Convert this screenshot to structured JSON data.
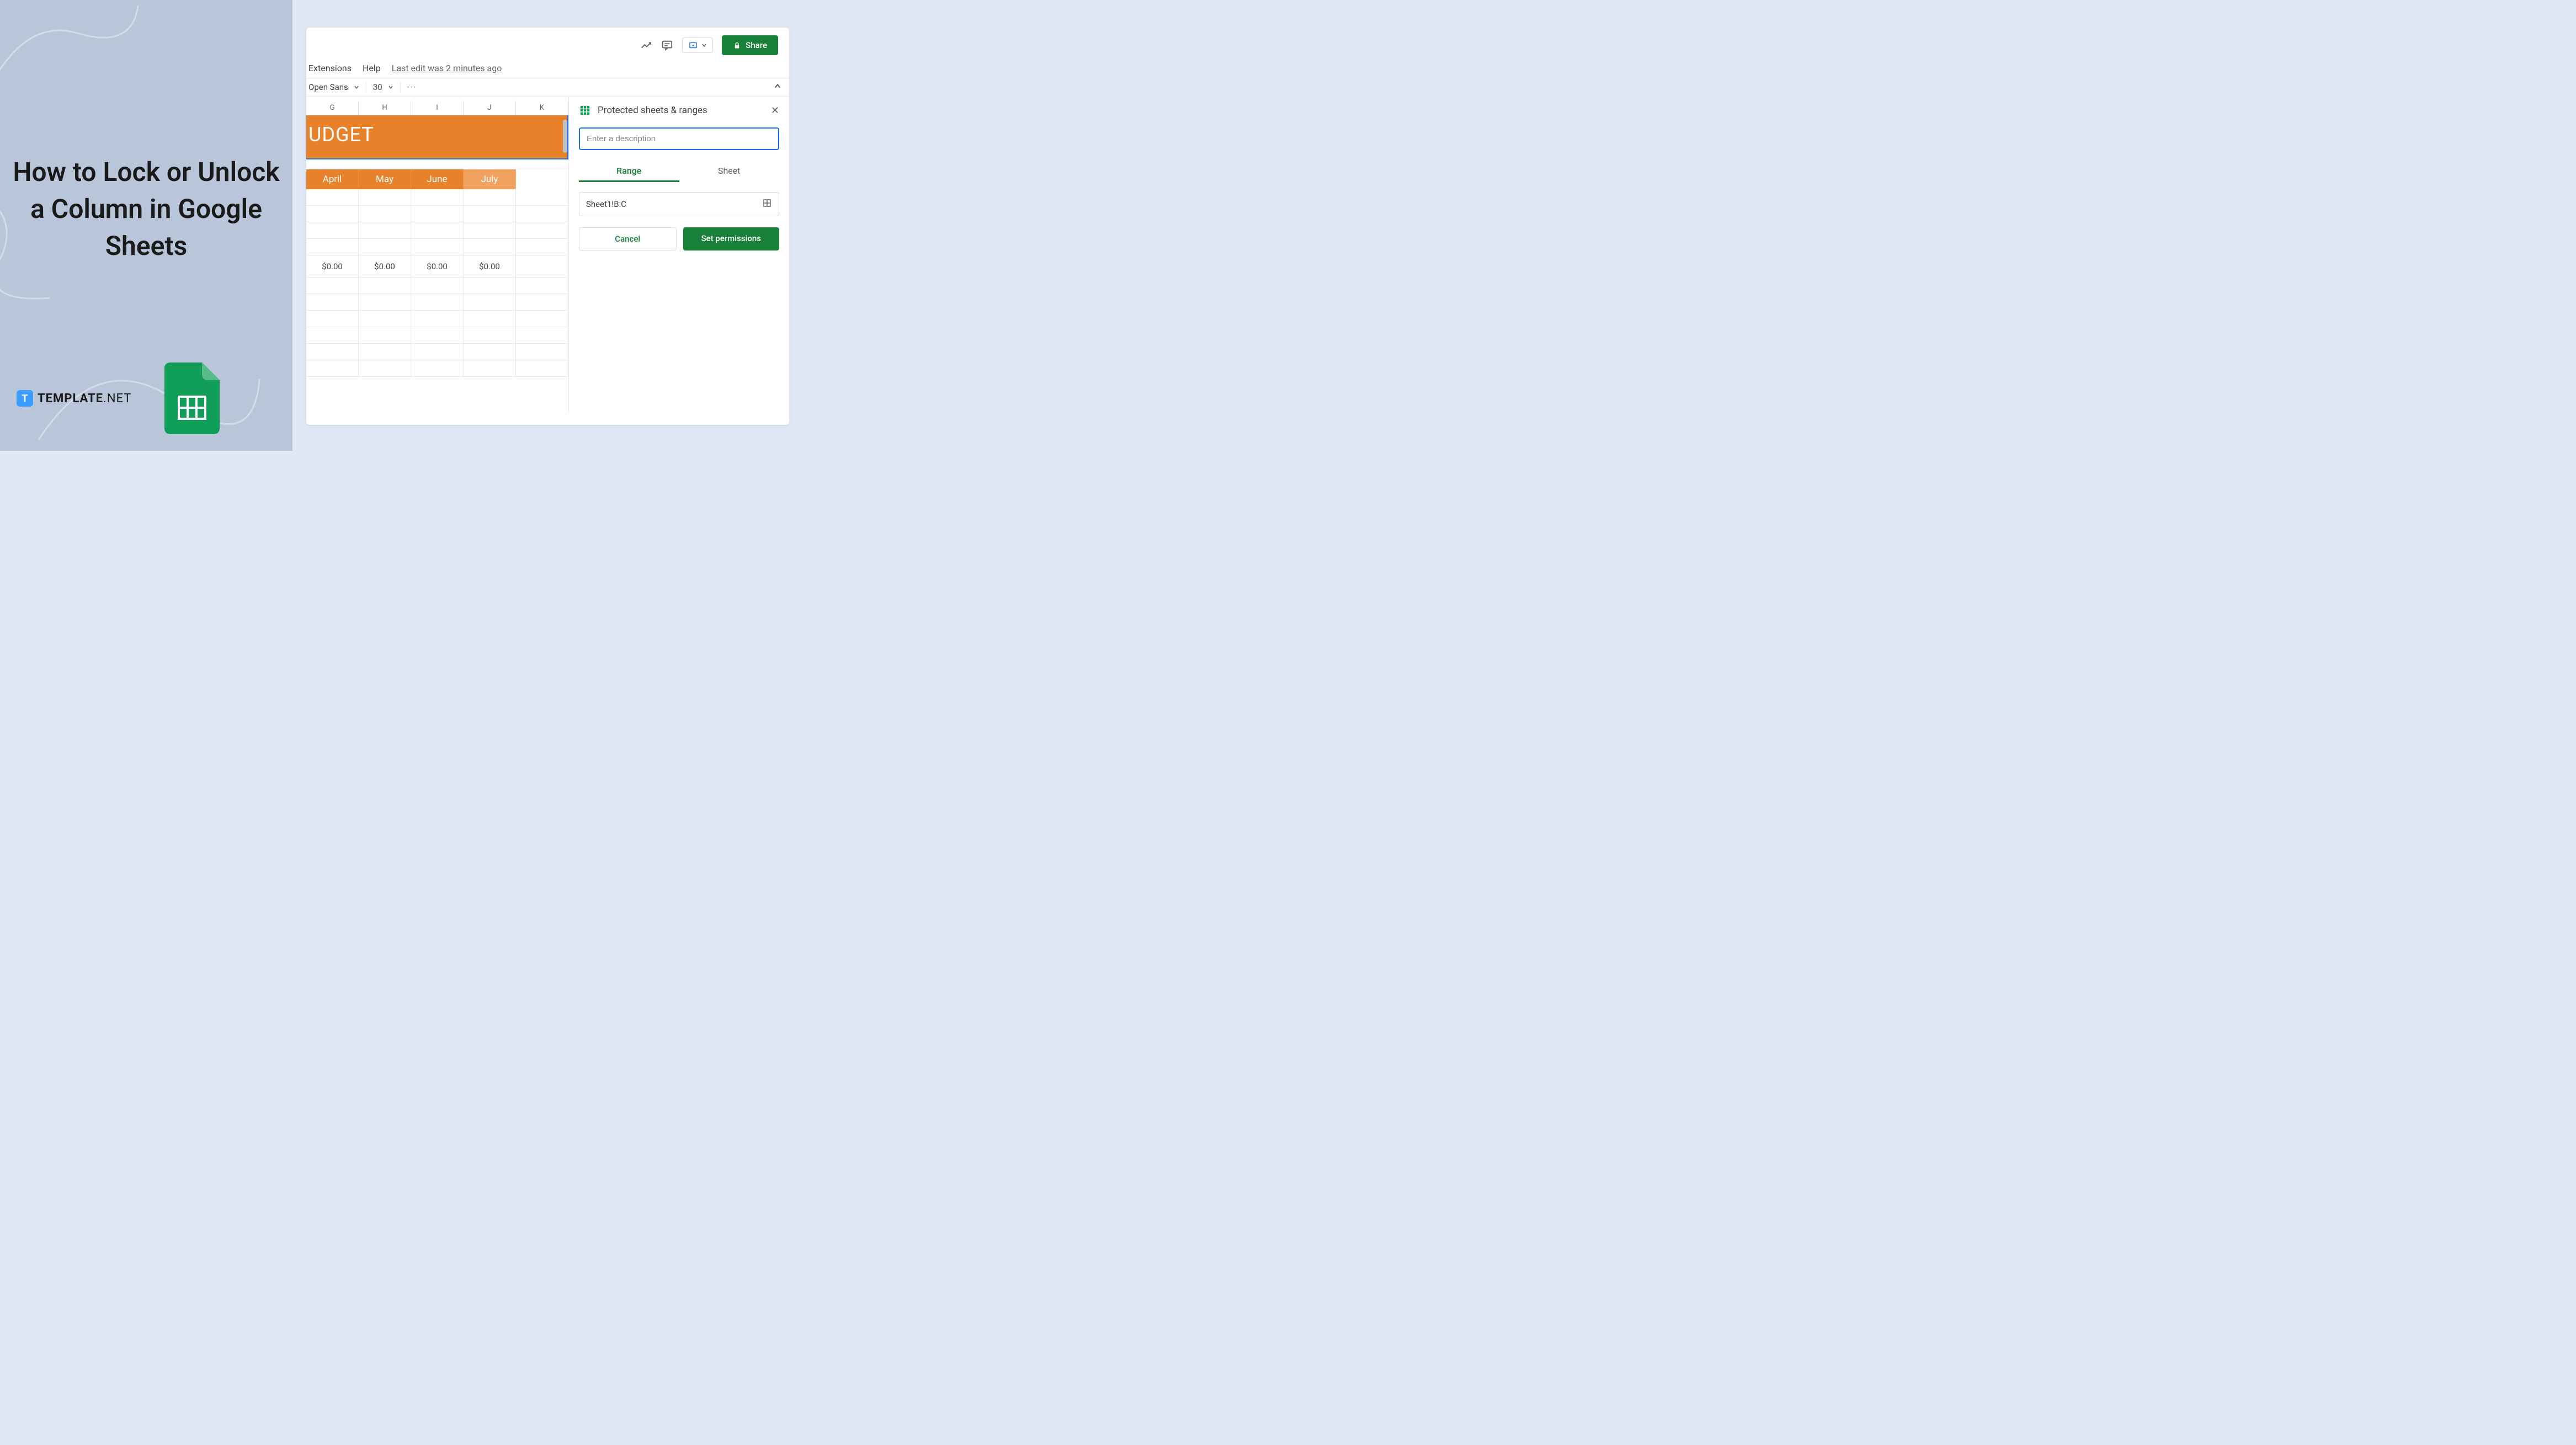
{
  "left": {
    "title": "How to Lock or Unlock a Column in Google Sheets",
    "brand_letter": "T",
    "brand_name": "TEMPLATE",
    "brand_suffix": ".NET"
  },
  "menu": {
    "extensions": "Extensions",
    "help": "Help",
    "last_edit": "Last edit was 2 minutes ago"
  },
  "toolbar": {
    "font": "Open Sans",
    "size": "30",
    "more": "···"
  },
  "sheet": {
    "columns": [
      "G",
      "H",
      "I",
      "J",
      "K"
    ],
    "title_fragment": "UDGET",
    "months": [
      "April",
      "May",
      "June",
      "July"
    ],
    "values": [
      "$0.00",
      "$0.00",
      "$0.00",
      "$0.00"
    ]
  },
  "panel": {
    "title": "Protected sheets & ranges",
    "desc_placeholder": "Enter a description",
    "tab_range": "Range",
    "tab_sheet": "Sheet",
    "range_value": "Sheet1!B:C",
    "cancel": "Cancel",
    "set_permissions": "Set permissions"
  },
  "share": {
    "label": "Share"
  }
}
